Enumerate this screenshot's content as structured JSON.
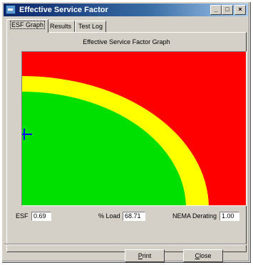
{
  "window": {
    "title": "Effective Service Factor",
    "minimize_glyph": "_",
    "maximize_glyph": "□",
    "close_glyph": "×"
  },
  "tabs": [
    {
      "label": "ESF Graph",
      "active": true
    },
    {
      "label": "Results",
      "active": false
    },
    {
      "label": "Test Log",
      "active": false
    }
  ],
  "graph": {
    "title": "Effective Service Factor Graph",
    "zone_colors": {
      "outer": "#ff0000",
      "band": "#ffff00",
      "inner": "#00e000"
    },
    "marker_color": "#0000ff"
  },
  "fields": {
    "esf_label": "ESF",
    "esf_value": "0.69",
    "load_label": "% Load",
    "load_value": "68.71",
    "nema_label": "NEMA Derating",
    "nema_value": "1.00"
  },
  "buttons": {
    "print_first": "P",
    "print_rest": "rint",
    "close_first": "C",
    "close_rest": "lose"
  }
}
